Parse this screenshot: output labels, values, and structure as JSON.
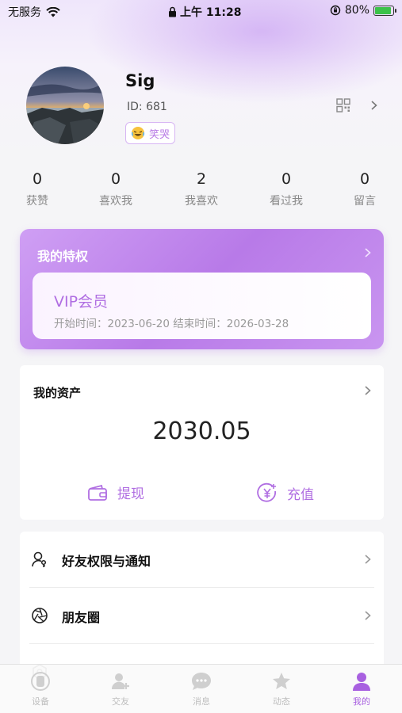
{
  "status_bar": {
    "carrier": "无服务",
    "time": "上午 11:28",
    "battery_percent": "80%"
  },
  "profile": {
    "nickname": "Sig",
    "id_label": "ID: 681",
    "tag_text": "笑哭"
  },
  "stats": [
    {
      "value": "0",
      "label": "获赞"
    },
    {
      "value": "0",
      "label": "喜欢我"
    },
    {
      "value": "2",
      "label": "我喜欢"
    },
    {
      "value": "0",
      "label": "看过我"
    },
    {
      "value": "0",
      "label": "留言"
    }
  ],
  "privilege": {
    "title": "我的特权",
    "vip_name": "VIP会员",
    "dates": "开始时间：2023-06-20 结束时间：2026-03-28"
  },
  "assets": {
    "title": "我的资产",
    "amount": "2030.05",
    "withdraw_label": "提现",
    "recharge_label": "充值"
  },
  "menu": {
    "items": [
      {
        "label": "好友权限与通知",
        "icon": "user-key-icon"
      },
      {
        "label": "朋友圈",
        "icon": "aperture-icon"
      }
    ]
  },
  "tabbar": {
    "tabs": [
      {
        "label": "设备",
        "icon": "device-icon"
      },
      {
        "label": "交友",
        "icon": "add-friend-icon"
      },
      {
        "label": "消息",
        "icon": "message-icon"
      },
      {
        "label": "动态",
        "icon": "star-icon"
      },
      {
        "label": "我的",
        "icon": "person-icon",
        "active": true
      }
    ]
  },
  "colors": {
    "accent": "#b06ee2",
    "vip_gradient_start": "#cf9ff4",
    "battery_green": "#3cc24a"
  }
}
